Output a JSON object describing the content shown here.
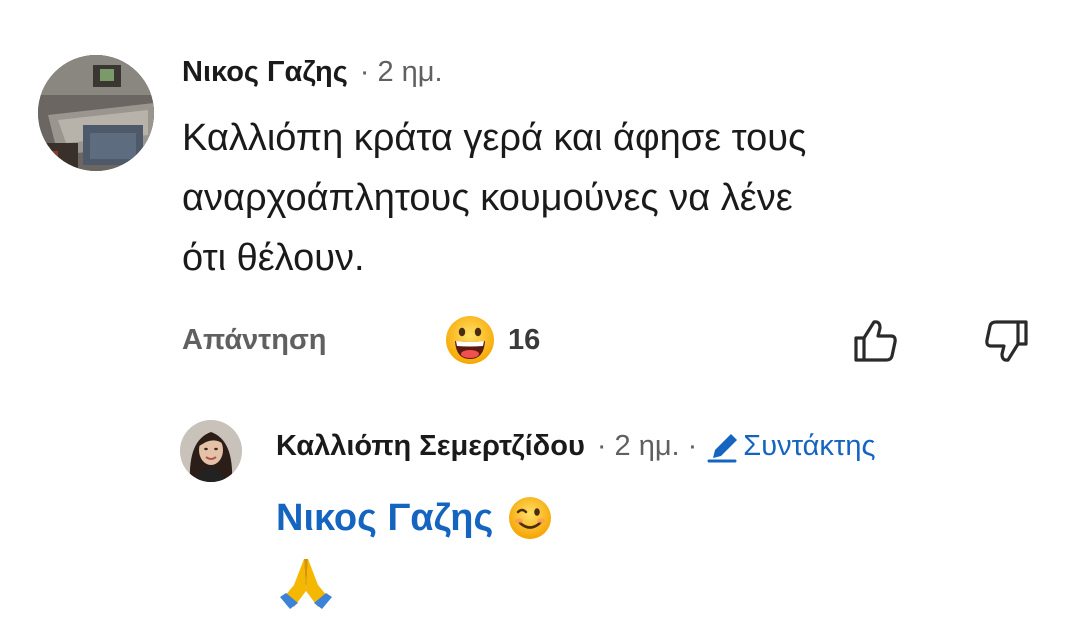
{
  "comment": {
    "author": "Νικος Γαζης",
    "separator": "·",
    "time": "2 ημ.",
    "text_lines": [
      "Καλλιόπη κράτα γερά και άφησε τους",
      "αναρχοάπλητους κουμούνες να λένε",
      "ότι θέλουν."
    ],
    "avatar_icon": "forklift-photo-avatar",
    "actions": {
      "reply_label": "Απάντηση",
      "reaction_icon": "grinning-face-icon",
      "reaction_count": "16",
      "like_icon": "thumbs-up-icon",
      "dislike_icon": "thumbs-down-icon"
    }
  },
  "reply": {
    "author": "Καλλιόπη Σεμερτζίδου",
    "separator": "·",
    "time": "2 ημ.",
    "editor_label": "Συντάκτης",
    "editor_icon": "pencil-icon",
    "avatar_icon": "woman-photo-avatar",
    "mention": "Νικος Γαζης",
    "emoji_1": "winking-face-icon",
    "emoji_2": "folded-hands-icon"
  },
  "colors": {
    "link_blue": "#1565c0",
    "meta_gray": "#606060",
    "text": "#1a1a1a"
  }
}
